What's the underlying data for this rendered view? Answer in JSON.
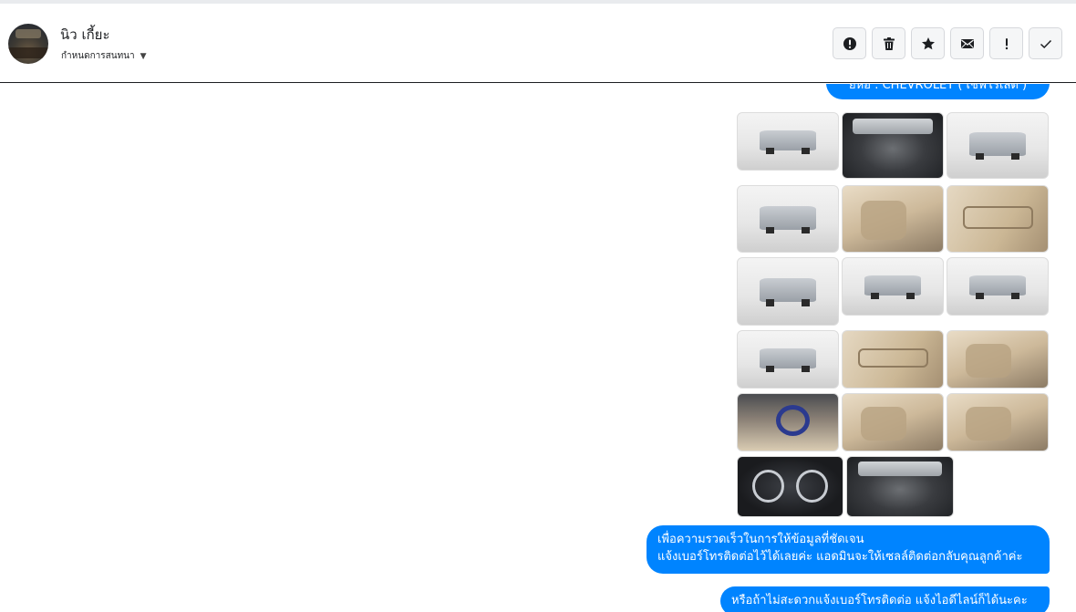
{
  "header": {
    "contact_name": "นิว เกี้ยะ",
    "subtitle": "กำหนดการสนทนา",
    "actions": [
      {
        "name": "report-button",
        "icon": "alert-circle-icon"
      },
      {
        "name": "delete-button",
        "icon": "trash-icon"
      },
      {
        "name": "star-button",
        "icon": "star-icon"
      },
      {
        "name": "mark-unread-button",
        "icon": "envelope-icon"
      },
      {
        "name": "important-button",
        "icon": "exclamation-icon"
      },
      {
        "name": "done-button",
        "icon": "checkmark-icon"
      }
    ]
  },
  "messages": {
    "top_bubble": "ยี่ห้อ : CHEVROLET ( เชฟโรเลต )",
    "info_line1": "เพื่อความรวดเร็วในการให้ข้อมูลที่ชัดเจน",
    "info_line2": "แจ้งเบอร์โทรติดต่อไว้ได้เลยค่ะ แอดมินจะให้เซลล์ติดต่อกลับคุณลูกค้าค่ะ",
    "last_bubble": "หรือถ้าไม่สะดวกแจ้งเบอร์โทรติดต่อ แจ้งไอดีไลน์ก็ได้นะคะ"
  },
  "photos": [
    "truck",
    "engine",
    "truck",
    "truck",
    "interior",
    "door",
    "truck",
    "truck",
    "truck",
    "truck",
    "door",
    "interior",
    "steering",
    "interior",
    "interior",
    "gauge",
    "engine"
  ],
  "colors": {
    "bubble": "#0084ff",
    "button_bg": "#f5f6f7"
  }
}
